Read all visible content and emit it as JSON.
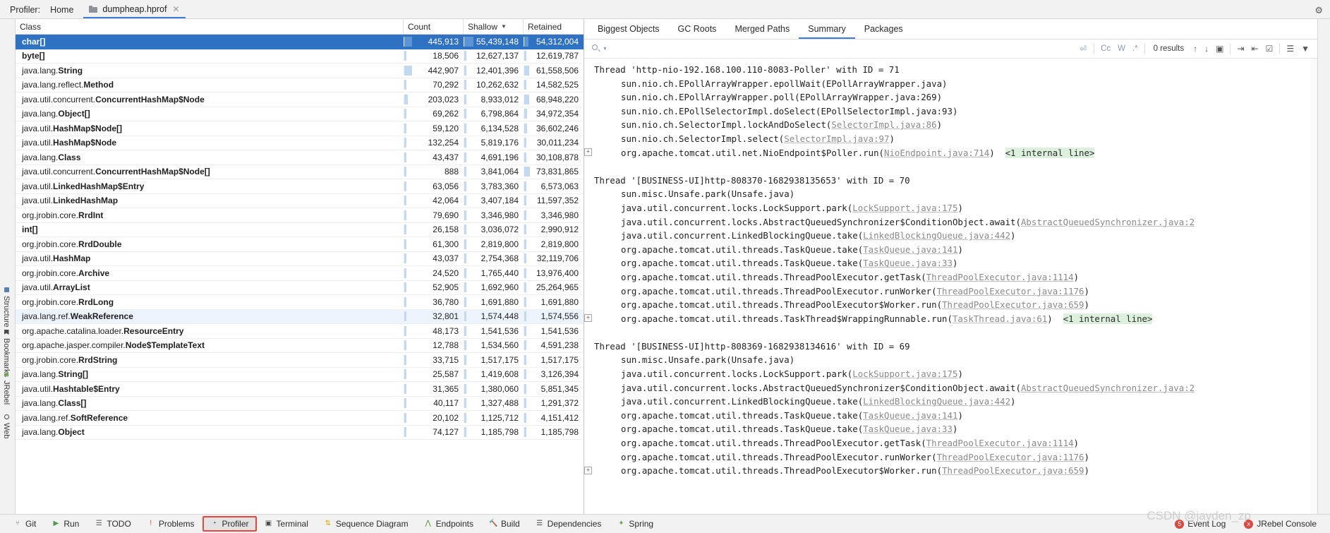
{
  "window": {
    "profiler_label": "Profiler:",
    "home_tab": "Home",
    "file_tab": "dumpheap.hprof",
    "close_icon": "close-icon",
    "settings_icon": "gear-icon"
  },
  "table": {
    "columns": [
      "Class",
      "Count",
      "Shallow",
      "Retained"
    ],
    "sorted_column": "Shallow",
    "sort_direction": "▼",
    "rows": [
      {
        "pkg": "",
        "cls": "char[]",
        "count": "445,913",
        "shallow": "55,439,148",
        "retained": "54,312,004",
        "count_bar": 0.33,
        "shallow_bar": 0.42,
        "retained_bar": 0.18,
        "state": "selected"
      },
      {
        "pkg": "",
        "cls": "byte[]",
        "count": "18,506",
        "shallow": "12,627,137",
        "retained": "12,619,787",
        "count_bar": 0.015,
        "shallow_bar": 0.1,
        "retained_bar": 0.042,
        "state": ""
      },
      {
        "pkg": "java.lang.",
        "cls": "String",
        "count": "442,907",
        "shallow": "12,401,396",
        "retained": "61,558,506",
        "count_bar": 0.33,
        "shallow_bar": 0.1,
        "retained_bar": 0.205,
        "state": ""
      },
      {
        "pkg": "java.lang.reflect.",
        "cls": "Method",
        "count": "70,292",
        "shallow": "10,262,632",
        "retained": "14,582,525",
        "count_bar": 0.055,
        "shallow_bar": 0.082,
        "retained_bar": 0.049,
        "state": ""
      },
      {
        "pkg": "java.util.concurrent.",
        "cls": "ConcurrentHashMap$Node",
        "count": "203,023",
        "shallow": "8,933,012",
        "retained": "68,948,220",
        "count_bar": 0.152,
        "shallow_bar": 0.072,
        "retained_bar": 0.23,
        "state": ""
      },
      {
        "pkg": "java.lang.",
        "cls": "Object[]",
        "count": "69,262",
        "shallow": "6,798,864",
        "retained": "34,972,354",
        "count_bar": 0.052,
        "shallow_bar": 0.055,
        "retained_bar": 0.117,
        "state": ""
      },
      {
        "pkg": "java.util.",
        "cls": "HashMap$Node[]",
        "count": "59,120",
        "shallow": "6,134,528",
        "retained": "36,602,246",
        "count_bar": 0.044,
        "shallow_bar": 0.049,
        "retained_bar": 0.122,
        "state": ""
      },
      {
        "pkg": "java.util.",
        "cls": "HashMap$Node",
        "count": "132,254",
        "shallow": "5,819,176",
        "retained": "30,011,234",
        "count_bar": 0.099,
        "shallow_bar": 0.047,
        "retained_bar": 0.1,
        "state": ""
      },
      {
        "pkg": "java.lang.",
        "cls": "Class",
        "count": "43,437",
        "shallow": "4,691,196",
        "retained": "30,108,878",
        "count_bar": 0.032,
        "shallow_bar": 0.038,
        "retained_bar": 0.1,
        "state": ""
      },
      {
        "pkg": "java.util.concurrent.",
        "cls": "ConcurrentHashMap$Node[]",
        "count": "888",
        "shallow": "3,841,064",
        "retained": "73,831,865",
        "count_bar": 0.004,
        "shallow_bar": 0.031,
        "retained_bar": 0.246,
        "state": ""
      },
      {
        "pkg": "java.util.",
        "cls": "LinkedHashMap$Entry",
        "count": "63,056",
        "shallow": "3,783,360",
        "retained": "6,573,063",
        "count_bar": 0.047,
        "shallow_bar": 0.03,
        "retained_bar": 0.022,
        "state": ""
      },
      {
        "pkg": "java.util.",
        "cls": "LinkedHashMap",
        "count": "42,064",
        "shallow": "3,407,184",
        "retained": "11,597,352",
        "count_bar": 0.031,
        "shallow_bar": 0.027,
        "retained_bar": 0.039,
        "state": ""
      },
      {
        "pkg": "org.jrobin.core.",
        "cls": "RrdInt",
        "count": "79,690",
        "shallow": "3,346,980",
        "retained": "3,346,980",
        "count_bar": 0.06,
        "shallow_bar": 0.027,
        "retained_bar": 0.011,
        "state": ""
      },
      {
        "pkg": "",
        "cls": "int[]",
        "count": "26,158",
        "shallow": "3,036,072",
        "retained": "2,990,912",
        "count_bar": 0.02,
        "shallow_bar": 0.024,
        "retained_bar": 0.01,
        "state": ""
      },
      {
        "pkg": "org.jrobin.core.",
        "cls": "RrdDouble",
        "count": "61,300",
        "shallow": "2,819,800",
        "retained": "2,819,800",
        "count_bar": 0.046,
        "shallow_bar": 0.023,
        "retained_bar": 0.009,
        "state": ""
      },
      {
        "pkg": "java.util.",
        "cls": "HashMap",
        "count": "43,037",
        "shallow": "2,754,368",
        "retained": "32,119,706",
        "count_bar": 0.032,
        "shallow_bar": 0.022,
        "retained_bar": 0.107,
        "state": ""
      },
      {
        "pkg": "org.jrobin.core.",
        "cls": "Archive",
        "count": "24,520",
        "shallow": "1,765,440",
        "retained": "13,976,400",
        "count_bar": 0.018,
        "shallow_bar": 0.014,
        "retained_bar": 0.047,
        "state": ""
      },
      {
        "pkg": "java.util.",
        "cls": "ArrayList",
        "count": "52,905",
        "shallow": "1,692,960",
        "retained": "25,264,965",
        "count_bar": 0.04,
        "shallow_bar": 0.014,
        "retained_bar": 0.084,
        "state": ""
      },
      {
        "pkg": "org.jrobin.core.",
        "cls": "RrdLong",
        "count": "36,780",
        "shallow": "1,691,880",
        "retained": "1,691,880",
        "count_bar": 0.027,
        "shallow_bar": 0.0135,
        "retained_bar": 0.006,
        "state": ""
      },
      {
        "pkg": "java.lang.ref.",
        "cls": "WeakReference",
        "count": "32,801",
        "shallow": "1,574,448",
        "retained": "1,574,556",
        "count_bar": 0.024,
        "shallow_bar": 0.0126,
        "retained_bar": 0.005,
        "state": "highlight"
      },
      {
        "pkg": "org.apache.catalina.loader.",
        "cls": "ResourceEntry",
        "count": "48,173",
        "shallow": "1,541,536",
        "retained": "1,541,536",
        "count_bar": 0.036,
        "shallow_bar": 0.0123,
        "retained_bar": 0.005,
        "state": ""
      },
      {
        "pkg": "org.apache.jasper.compiler.",
        "cls": "Node$TemplateText",
        "count": "12,788",
        "shallow": "1,534,560",
        "retained": "4,591,238",
        "count_bar": 0.01,
        "shallow_bar": 0.0123,
        "retained_bar": 0.015,
        "state": ""
      },
      {
        "pkg": "org.jrobin.core.",
        "cls": "RrdString",
        "count": "33,715",
        "shallow": "1,517,175",
        "retained": "1,517,175",
        "count_bar": 0.025,
        "shallow_bar": 0.0121,
        "retained_bar": 0.005,
        "state": ""
      },
      {
        "pkg": "java.lang.",
        "cls": "String[]",
        "count": "25,587",
        "shallow": "1,419,608",
        "retained": "3,126,394",
        "count_bar": 0.019,
        "shallow_bar": 0.0114,
        "retained_bar": 0.01,
        "state": ""
      },
      {
        "pkg": "java.util.",
        "cls": "Hashtable$Entry",
        "count": "31,365",
        "shallow": "1,380,060",
        "retained": "5,851,345",
        "count_bar": 0.023,
        "shallow_bar": 0.011,
        "retained_bar": 0.019,
        "state": ""
      },
      {
        "pkg": "java.lang.",
        "cls": "Class[]",
        "count": "40,117",
        "shallow": "1,327,488",
        "retained": "1,291,372",
        "count_bar": 0.03,
        "shallow_bar": 0.0106,
        "retained_bar": 0.004,
        "state": ""
      },
      {
        "pkg": "java.lang.ref.",
        "cls": "SoftReference",
        "count": "20,102",
        "shallow": "1,125,712",
        "retained": "4,151,412",
        "count_bar": 0.015,
        "shallow_bar": 0.009,
        "retained_bar": 0.014,
        "state": ""
      },
      {
        "pkg": "java.lang.",
        "cls": "Object",
        "count": "74,127",
        "shallow": "1,185,798",
        "retained": "1,185,798",
        "count_bar": 0.055,
        "shallow_bar": 0.0095,
        "retained_bar": 0.004,
        "state": ""
      }
    ]
  },
  "detail": {
    "tabs": [
      "Biggest Objects",
      "GC Roots",
      "Merged Paths",
      "Summary",
      "Packages"
    ],
    "active_tab": "Summary",
    "search": {
      "placeholder": "",
      "value": "",
      "results_label": "0 results",
      "match_case": "Cc",
      "whole_words": "W",
      "regex": ".*",
      "prev_icon": "arrow-up-icon",
      "next_icon": "arrow-down-icon",
      "select_all_icon": "select-all-icon",
      "expand_icon": "expand-icon",
      "collapse_icon": "collapse-icon",
      "checkbox_icon": "checkbox-icon",
      "list_icon": "list-icon",
      "filter_icon": "filter-icon"
    },
    "stack_lines": [
      {
        "indent": 0,
        "type": "thread",
        "text": "Thread 'http-nio-192.168.100.110-8083-Poller' with ID = 71"
      },
      {
        "indent": 1,
        "type": "frame",
        "text": "sun.nio.ch.EPollArrayWrapper.epollWait(EPollArrayWrapper.java)"
      },
      {
        "indent": 1,
        "type": "frame",
        "text": "sun.nio.ch.EPollArrayWrapper.poll(EPollArrayWrapper.java:269)"
      },
      {
        "indent": 1,
        "type": "frame",
        "text": "sun.nio.ch.EPollSelectorImpl.doSelect(EPollSelectorImpl.java:93)"
      },
      {
        "indent": 1,
        "type": "frame",
        "pre": "sun.nio.ch.SelectorImpl.lockAndDoSelect(",
        "link": "SelectorImpl.java:86",
        "post": ")"
      },
      {
        "indent": 1,
        "type": "frame",
        "pre": "sun.nio.ch.SelectorImpl.select(",
        "link": "SelectorImpl.java:97",
        "post": ")"
      },
      {
        "indent": 1,
        "type": "frame",
        "plus": true,
        "pre": "org.apache.tomcat.util.net.NioEndpoint$Poller.run(",
        "link": "NioEndpoint.java:714",
        "post": ")",
        "tag": "<1 internal line>"
      },
      {
        "indent": 0,
        "type": "blank",
        "text": ""
      },
      {
        "indent": 0,
        "type": "thread",
        "text": "Thread '[BUSINESS-UI]http-808370-1682938135653' with ID = 70"
      },
      {
        "indent": 1,
        "type": "frame",
        "text": "sun.misc.Unsafe.park(Unsafe.java)"
      },
      {
        "indent": 1,
        "type": "frame",
        "pre": "java.util.concurrent.locks.LockSupport.park(",
        "link": "LockSupport.java:175",
        "post": ")"
      },
      {
        "indent": 1,
        "type": "frame",
        "pre": "java.util.concurrent.locks.AbstractQueuedSynchronizer$ConditionObject.await(",
        "link": "AbstractQueuedSynchronizer.java:2",
        "post": ""
      },
      {
        "indent": 1,
        "type": "frame",
        "pre": "java.util.concurrent.LinkedBlockingQueue.take(",
        "link": "LinkedBlockingQueue.java:442",
        "post": ")"
      },
      {
        "indent": 1,
        "type": "frame",
        "pre": "org.apache.tomcat.util.threads.TaskQueue.take(",
        "link": "TaskQueue.java:141",
        "post": ")"
      },
      {
        "indent": 1,
        "type": "frame",
        "pre": "org.apache.tomcat.util.threads.TaskQueue.take(",
        "link": "TaskQueue.java:33",
        "post": ")"
      },
      {
        "indent": 1,
        "type": "frame",
        "pre": "org.apache.tomcat.util.threads.ThreadPoolExecutor.getTask(",
        "link": "ThreadPoolExecutor.java:1114",
        "post": ")"
      },
      {
        "indent": 1,
        "type": "frame",
        "pre": "org.apache.tomcat.util.threads.ThreadPoolExecutor.runWorker(",
        "link": "ThreadPoolExecutor.java:1176",
        "post": ")"
      },
      {
        "indent": 1,
        "type": "frame",
        "pre": "org.apache.tomcat.util.threads.ThreadPoolExecutor$Worker.run(",
        "link": "ThreadPoolExecutor.java:659",
        "post": ")"
      },
      {
        "indent": 1,
        "type": "frame",
        "plus": true,
        "pre": "org.apache.tomcat.util.threads.TaskThread$WrappingRunnable.run(",
        "link": "TaskThread.java:61",
        "post": ")",
        "tag": "<1 internal line>"
      },
      {
        "indent": 0,
        "type": "blank",
        "text": ""
      },
      {
        "indent": 0,
        "type": "thread",
        "text": "Thread '[BUSINESS-UI]http-808369-1682938134616' with ID = 69"
      },
      {
        "indent": 1,
        "type": "frame",
        "text": "sun.misc.Unsafe.park(Unsafe.java)"
      },
      {
        "indent": 1,
        "type": "frame",
        "pre": "java.util.concurrent.locks.LockSupport.park(",
        "link": "LockSupport.java:175",
        "post": ")"
      },
      {
        "indent": 1,
        "type": "frame",
        "pre": "java.util.concurrent.locks.AbstractQueuedSynchronizer$ConditionObject.await(",
        "link": "AbstractQueuedSynchronizer.java:2",
        "post": ""
      },
      {
        "indent": 1,
        "type": "frame",
        "pre": "java.util.concurrent.LinkedBlockingQueue.take(",
        "link": "LinkedBlockingQueue.java:442",
        "post": ")"
      },
      {
        "indent": 1,
        "type": "frame",
        "pre": "org.apache.tomcat.util.threads.TaskQueue.take(",
        "link": "TaskQueue.java:141",
        "post": ")"
      },
      {
        "indent": 1,
        "type": "frame",
        "pre": "org.apache.tomcat.util.threads.TaskQueue.take(",
        "link": "TaskQueue.java:33",
        "post": ")"
      },
      {
        "indent": 1,
        "type": "frame",
        "pre": "org.apache.tomcat.util.threads.ThreadPoolExecutor.getTask(",
        "link": "ThreadPoolExecutor.java:1114",
        "post": ")"
      },
      {
        "indent": 1,
        "type": "frame",
        "pre": "org.apache.tomcat.util.threads.ThreadPoolExecutor.runWorker(",
        "link": "ThreadPoolExecutor.java:1176",
        "post": ")"
      },
      {
        "indent": 1,
        "type": "frame",
        "plus": true,
        "pre": "org.apache.tomcat.util.threads.ThreadPoolExecutor$Worker.run(",
        "link": "ThreadPoolExecutor.java:659",
        "post": ")"
      }
    ]
  },
  "left_rail": [
    {
      "label": "Structure",
      "icon": "structure-icon"
    },
    {
      "label": "Bookmarks",
      "icon": "bookmark-icon"
    },
    {
      "label": "JRebel",
      "icon": "jrebel-icon"
    },
    {
      "label": "Web",
      "icon": "web-icon"
    }
  ],
  "bottom_bar": {
    "items": [
      {
        "label": "Git",
        "icon": "git-icon",
        "active": false
      },
      {
        "label": "Run",
        "icon": "run-icon",
        "active": false
      },
      {
        "label": "TODO",
        "icon": "todo-icon",
        "active": false
      },
      {
        "label": "Problems",
        "icon": "problems-icon",
        "active": false
      },
      {
        "label": "Profiler",
        "icon": "profiler-icon",
        "active": true
      },
      {
        "label": "Terminal",
        "icon": "terminal-icon",
        "active": false
      },
      {
        "label": "Sequence Diagram",
        "icon": "sequence-diagram-icon",
        "active": false
      },
      {
        "label": "Endpoints",
        "icon": "endpoints-icon",
        "active": false
      },
      {
        "label": "Build",
        "icon": "build-icon",
        "active": false
      },
      {
        "label": "Dependencies",
        "icon": "dependencies-icon",
        "active": false
      },
      {
        "label": "Spring",
        "icon": "spring-icon",
        "active": false
      }
    ],
    "right": [
      {
        "label": "Event Log",
        "icon": "event-log-icon",
        "badge": "5"
      },
      {
        "label": "JRebel Console",
        "icon": "jrebel-console-icon",
        "badge": "x"
      }
    ],
    "watermark": "CSDN @jayden_zp"
  },
  "colors": {
    "accent": "#3b7dd8",
    "selection": "#2f72c4",
    "bar": "#c3d9f2",
    "highlight_row": "#edf4fd",
    "internal_tag": "#ddf0dd",
    "error": "#e8453c"
  }
}
